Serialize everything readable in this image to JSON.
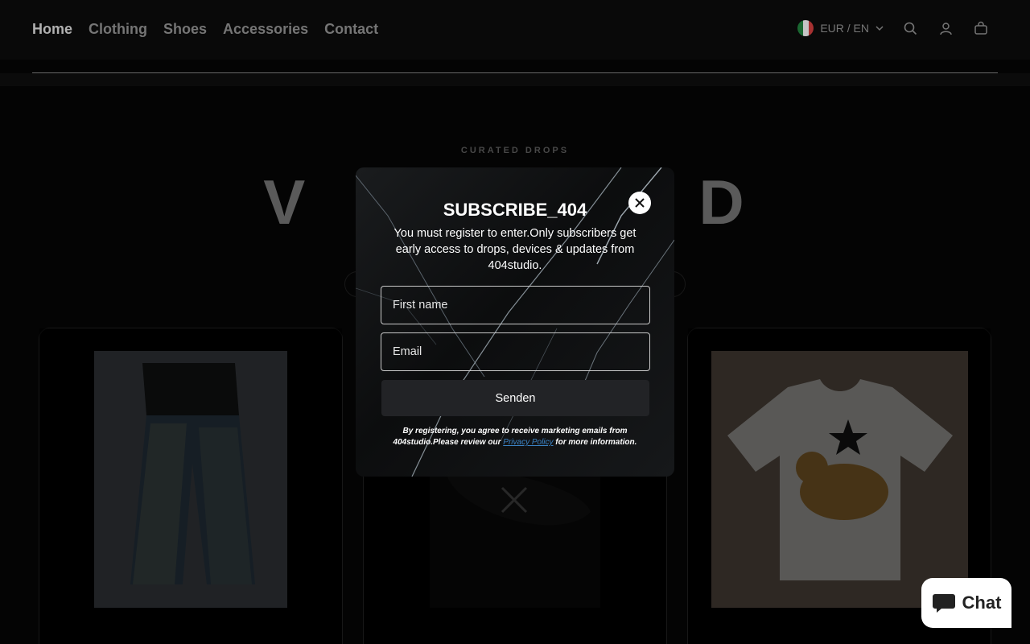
{
  "header": {
    "nav": [
      "Home",
      "Clothing",
      "Shoes",
      "Accessories",
      "Contact"
    ],
    "locale": "EUR / EN",
    "icons": [
      "search-icon",
      "account-icon",
      "cart-icon"
    ]
  },
  "hero": {
    "eyebrow": "CURATED DROPS",
    "title_left": "V A",
    "title_right": "D"
  },
  "modal": {
    "title": "SUBSCRIBE_404",
    "description": "You must register to enter.Only subscribers get early access to drops, devices & updates from 404studio.",
    "first_name_placeholder": "First name",
    "email_placeholder": "Email",
    "submit_label": "Senden",
    "legal_before": "By registering, you agree to receive marketing emails from 404studio.Please review our ",
    "legal_link": "Privacy Policy",
    "legal_after": " for more information."
  },
  "chat": {
    "label": "Chat"
  },
  "colors": {
    "background": "#050505",
    "accent_link": "#3b82c4"
  }
}
